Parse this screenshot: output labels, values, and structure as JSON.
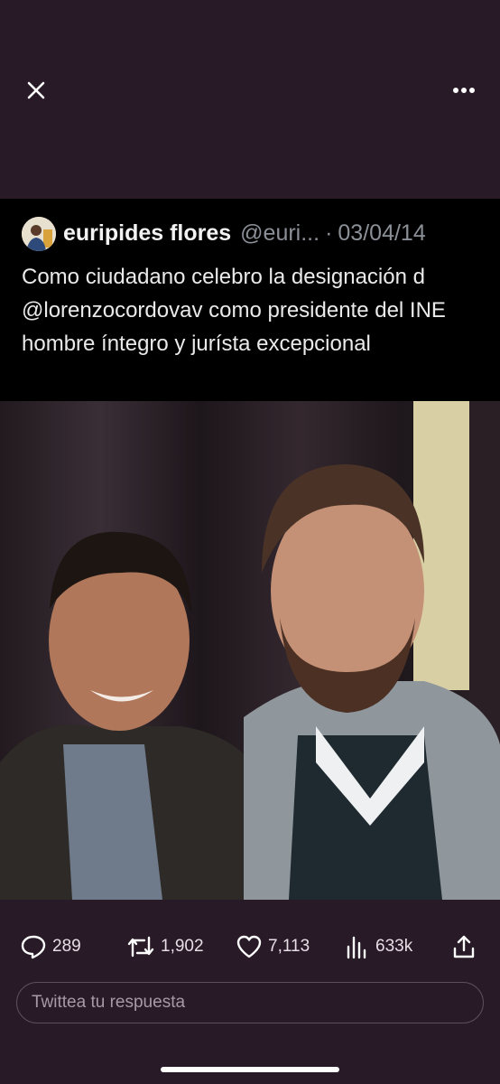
{
  "viewer": {
    "close_icon": "close-icon",
    "more_icon": "more-horizontal-icon"
  },
  "tweet": {
    "author_name": "euripides flores",
    "handle": "@euri...",
    "separator": "·",
    "date": "03/04/14",
    "text": "Como ciudadano celebro la designación d @lorenzocordovav como presidente del INE hombre íntegro y jurísta excepcional"
  },
  "actions": {
    "replies": "289",
    "retweets": "1,902",
    "likes": "7,113",
    "views": "633k"
  },
  "reply": {
    "placeholder": "Twittea tu respuesta"
  },
  "colors": {
    "background": "#281a26",
    "embed_background": "#000000",
    "muted_text": "#8b8f96"
  }
}
